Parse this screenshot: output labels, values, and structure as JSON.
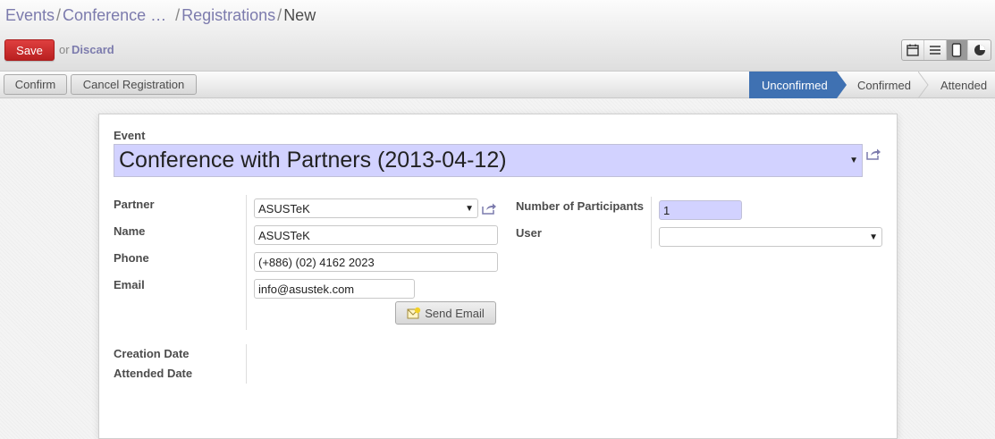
{
  "breadcrumb": {
    "items": [
      "Events",
      "Conference …",
      "Registrations"
    ],
    "separator": "/",
    "current": "New"
  },
  "toolbar": {
    "save_label": "Save",
    "or_label": "or",
    "discard_label": "Discard",
    "views": [
      "calendar-icon",
      "list-icon",
      "form-icon",
      "graph-icon"
    ],
    "active_view": "form-icon"
  },
  "statusbar": {
    "buttons": [
      "Confirm",
      "Cancel Registration"
    ],
    "stages": [
      "Unconfirmed",
      "Confirmed",
      "Attended"
    ],
    "active_stage": "Unconfirmed"
  },
  "form": {
    "event_label": "Event",
    "event_value": "Conference with Partners (2013-04-12)",
    "partner_label": "Partner",
    "partner_value": "ASUSTeK",
    "name_label": "Name",
    "name_value": "ASUSTeK",
    "phone_label": "Phone",
    "phone_value": "(+886) (02) 4162 2023",
    "email_label": "Email",
    "email_value": "info@asustek.com",
    "send_email_label": "Send Email",
    "participants_label": "Number of Participants",
    "participants_value": "1",
    "user_label": "User",
    "user_value": "",
    "creation_date_label": "Creation Date",
    "attended_date_label": "Attended Date"
  },
  "colors": {
    "link": "#7c7bad",
    "save": "#c22d2d",
    "active_stage": "#3f71b2",
    "required_field": "#d2d2ff"
  }
}
